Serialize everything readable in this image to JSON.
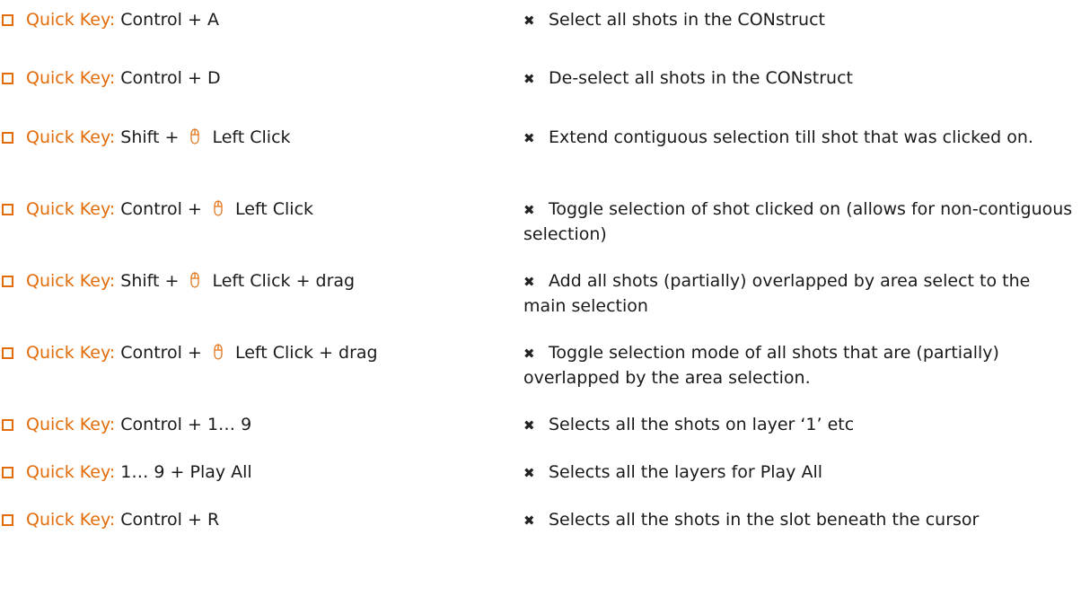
{
  "items": [
    {
      "prefix": "Quick Key:",
      "keys_before": "Control + A",
      "mouse": false,
      "keys_after": "",
      "desc": "Select all shots in the CONstruct"
    },
    {
      "prefix": "Quick Key:",
      "keys_before": "Control + D",
      "mouse": false,
      "keys_after": "",
      "desc": "De-select all shots in the CONstruct"
    },
    {
      "prefix": "Quick Key:",
      "keys_before": "Shift + ",
      "mouse": true,
      "keys_after": "Left Click",
      "desc": "Extend contiguous selection till shot that was clicked on."
    },
    {
      "prefix": "Quick Key:",
      "keys_before": "Control + ",
      "mouse": true,
      "keys_after": "Left Click",
      "desc": "Toggle selection of shot clicked on (allows for non-contiguous selection)"
    },
    {
      "prefix": "Quick Key:",
      "keys_before": "Shift + ",
      "mouse": true,
      "keys_after": "Left Click + drag",
      "desc": "Add all shots (partially) overlapped by area select to the main selection"
    },
    {
      "prefix": "Quick Key:",
      "keys_before": "Control + ",
      "mouse": true,
      "keys_after": "Left Click + drag",
      "desc": "Toggle selection mode of all shots that are (partially) overlapped by the area selection."
    },
    {
      "prefix": "Quick Key:",
      "keys_before": "Control + 1… 9",
      "mouse": false,
      "keys_after": "",
      "desc": "Selects all the shots on layer ‘1’ etc"
    },
    {
      "prefix": "Quick Key:",
      "keys_before": "1… 9 + Play All",
      "mouse": false,
      "keys_after": "",
      "desc": "Selects all the layers for Play All"
    },
    {
      "prefix": "Quick Key:",
      "keys_before": "Control + R",
      "mouse": false,
      "keys_after": "",
      "desc": "Selects all the shots in the slot beneath the cursor"
    }
  ],
  "icons": {
    "checkbox": "square-bullet-icon",
    "bullet": "cross-bullet-icon",
    "mouse": "mouse-icon"
  },
  "colors": {
    "accent": "#e36c0a",
    "text": "#1a1a1a"
  }
}
